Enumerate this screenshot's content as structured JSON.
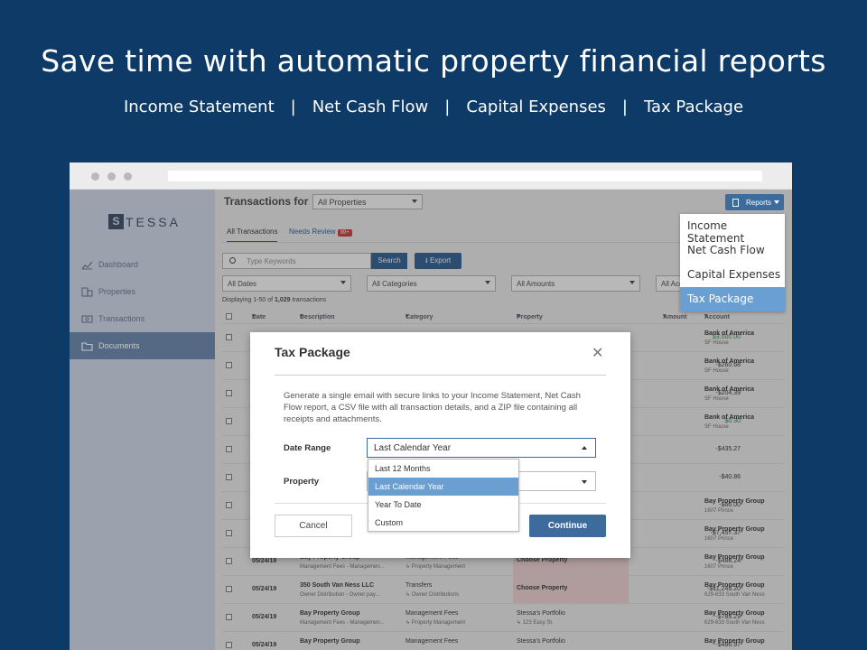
{
  "hero": {
    "title": "Save time with automatic property financial reports",
    "reports": [
      "Income Statement",
      "Net Cash Flow",
      "Capital Expenses",
      "Tax Package"
    ],
    "separator": "|"
  },
  "sidebar": {
    "logo_mark": "S",
    "logo_text": "TESSA",
    "items": [
      {
        "label": "Dashboard",
        "icon": "chart-icon"
      },
      {
        "label": "Properties",
        "icon": "building-icon"
      },
      {
        "label": "Transactions",
        "icon": "money-icon"
      },
      {
        "label": "Documents",
        "icon": "folder-icon",
        "active": true
      }
    ]
  },
  "header": {
    "transactions_for": "Transactions for",
    "property_select": "All Properties",
    "reports_button": "Reports"
  },
  "tabs": {
    "all": "All Transactions",
    "needs_review": "Needs Review",
    "needs_review_badge": "99+"
  },
  "toolbar": {
    "search_placeholder": "Type Keywords",
    "search_button": "Search",
    "export_button": "Export"
  },
  "filters": [
    "All Dates",
    "All Categories",
    "All Amounts",
    "All Acc"
  ],
  "count": {
    "prefix": "Displaying 1-50 of ",
    "total": "1,029",
    "suffix": " transactions"
  },
  "columns": [
    "Date",
    "Description",
    "Category",
    "Property",
    "Amount",
    "Account"
  ],
  "rows": [
    {
      "date": "",
      "desc": "",
      "desc_sub": "",
      "cat": "",
      "cat_sub": "",
      "prop": "",
      "prop_sub": "",
      "amount": "$3,000.00",
      "green": true,
      "acct": "Bank of America",
      "acct_sub": "SF House"
    },
    {
      "date": "",
      "desc": "",
      "desc_sub": "",
      "cat": "",
      "cat_sub": "",
      "prop": "",
      "prop_sub": "",
      "amount": "-$260.68",
      "acct": "Bank of America",
      "acct_sub": "SF House"
    },
    {
      "date": "",
      "desc": "",
      "desc_sub": "",
      "cat": "",
      "cat_sub": "",
      "prop": "",
      "prop_sub": "",
      "amount": "-$204.39",
      "acct": "Bank of America",
      "acct_sub": "SF House"
    },
    {
      "date": "",
      "desc": "",
      "desc_sub": "",
      "cat": "",
      "cat_sub": "",
      "prop": "",
      "prop_sub": "",
      "amount": "$0.30",
      "green": true,
      "acct": "Bank of America",
      "acct_sub": "SF House"
    },
    {
      "date": "",
      "desc": "",
      "desc_sub": "",
      "cat": "",
      "cat_sub": "",
      "prop": "",
      "prop_sub": "",
      "amount": "-$435.27",
      "acct": "",
      "acct_sub": ""
    },
    {
      "date": "",
      "desc": "",
      "desc_sub": "",
      "cat": "",
      "cat_sub": "",
      "prop": "",
      "prop_sub": "",
      "amount": "-$40.86",
      "acct": "",
      "acct_sub": ""
    },
    {
      "date": "",
      "desc": "",
      "desc_sub": "",
      "cat": "",
      "cat_sub": "",
      "prop": "",
      "prop_sub": "",
      "amount": "-$60.00",
      "acct": "Bay Property Group",
      "acct_sub": "1607 Prince"
    },
    {
      "date": "",
      "desc": "",
      "desc_sub": "",
      "cat": "",
      "cat_sub": "",
      "prop": "",
      "prop_sub": "",
      "amount": "-$7,457.37",
      "acct": "Bay Property Group",
      "acct_sub": "1607 Prince"
    },
    {
      "date": "05/24/19",
      "desc": "Bay Property Group",
      "desc_sub": "Management Fees - Managemen...",
      "cat": "Management Fees",
      "cat_sub": "↳ Property Management",
      "prop": "Choose Property",
      "choose": true,
      "prop_sub": "",
      "amount": "-$488.24",
      "acct": "Bay Property Group",
      "acct_sub": "1607 Prince"
    },
    {
      "date": "05/24/19",
      "desc": "350 South Van Ness LLC",
      "desc_sub": "Owner Distribution - Owner pay...",
      "cat": "Transfers",
      "cat_sub": "↳ Owner Distributions",
      "prop": "Choose Property",
      "choose": true,
      "prop_sub": "",
      "amount": "-$11,243.20",
      "acct": "Bay Property Group",
      "acct_sub": "629-633 South Van Ness"
    },
    {
      "date": "05/24/19",
      "desc": "Bay Property Group",
      "desc_sub": "Management Fees - Managemen...",
      "cat": "Management Fees",
      "cat_sub": "↳ Property Management",
      "prop": "Stessa's Portfolio",
      "prop_sub": "↳ 123 Easy St.",
      "amount": "-$783.29",
      "acct": "Bay Property Group",
      "acct_sub": "629-633 South Van Ness"
    },
    {
      "date": "05/24/19",
      "desc": "Bay Property Group",
      "desc_sub": "",
      "cat": "Management Fees",
      "cat_sub": "",
      "prop": "Stessa's Portfolio",
      "prop_sub": "",
      "amount": "-$480.97",
      "acct": "Bay Property Group",
      "acct_sub": ""
    }
  ],
  "menu": {
    "items": [
      "Income Statement",
      "Net Cash Flow",
      "Capital Expenses",
      "Tax Package"
    ],
    "active_index": 3
  },
  "modal": {
    "title": "Tax Package",
    "description": "Generate a single email with secure links to your Income Statement, Net Cash Flow report, a CSV file with all transaction details, and a ZIP file containing all receipts and attachments.",
    "date_range_label": "Date Range",
    "date_range_value": "Last Calendar Year",
    "property_label": "Property",
    "cancel": "Cancel",
    "continue": "Continue",
    "options": [
      "Last 12 Months",
      "Last Calendar Year",
      "Year To Date",
      "Custom"
    ],
    "selected_option_index": 1
  },
  "colors": {
    "background": "#0d3a66",
    "accent": "#3d6b9e",
    "highlight": "#6a9fd4",
    "positive": "#2e9b4e",
    "badge": "#d24a4a"
  }
}
